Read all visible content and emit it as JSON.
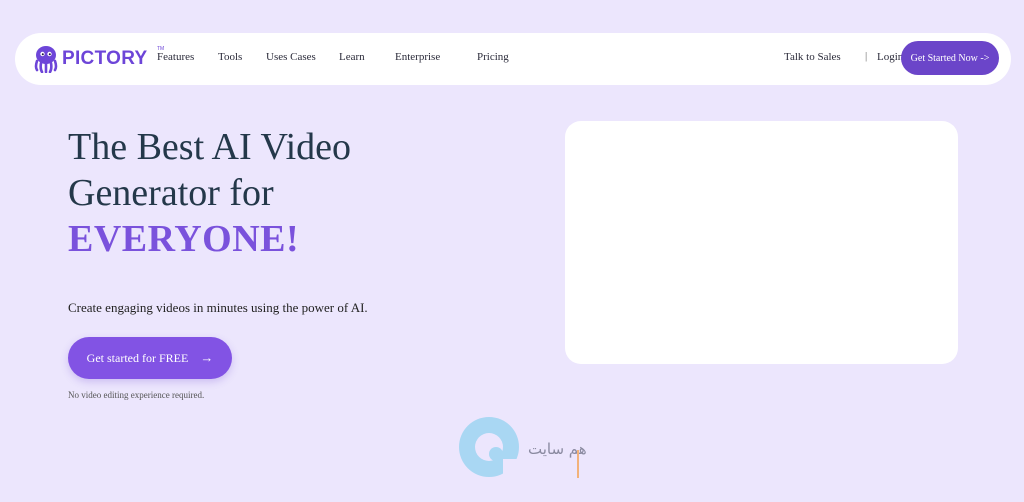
{
  "brand": {
    "name": "PICTORY",
    "tm": "TM",
    "color": "#6d45d8"
  },
  "nav": {
    "links": [
      "Features",
      "Tools",
      "Uses Cases",
      "Learn",
      "Enterprise",
      "Pricing"
    ],
    "talk": "Talk to Sales",
    "separator": "|",
    "login": "Login",
    "cta": "Get Started Now ->"
  },
  "hero": {
    "title_line1": "The Best AI Video",
    "title_line2": "Generator for",
    "title_accent": "EVERYONE!",
    "subtitle": "Create engaging videos in minutes using the power of AI.",
    "cta_label": "Get started for FREE",
    "cta_icon": "arrow-right-icon",
    "note": "No video editing experience required."
  },
  "watermark": {
    "text": "هم سایت"
  },
  "colors": {
    "background": "#ece6fd",
    "accent": "#7a52dc",
    "nav_cta": "#6b45c9",
    "hero_cta": "#8253e4"
  }
}
